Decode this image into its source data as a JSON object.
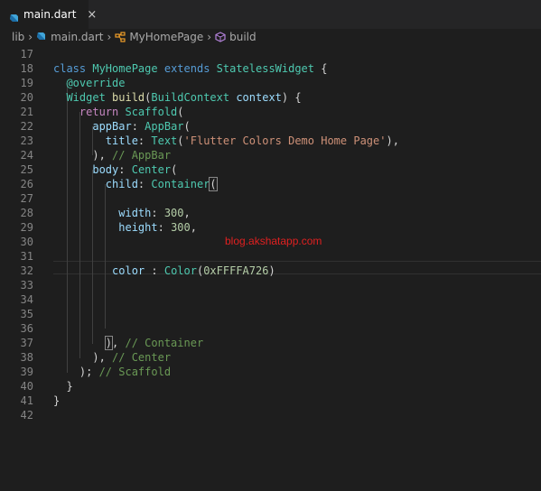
{
  "tab": {
    "label": "main.dart",
    "close": "×",
    "icon": "dart-icon"
  },
  "breadcrumb": {
    "items": [
      {
        "label": "lib",
        "icon": ""
      },
      {
        "label": "main.dart",
        "icon": "dart-icon"
      },
      {
        "label": "MyHomePage",
        "icon": "class-icon"
      },
      {
        "label": "build",
        "icon": "method-icon"
      }
    ]
  },
  "watermark": "blog.akshatapp.com",
  "lines": [
    {
      "n": "17",
      "tokens": []
    },
    {
      "n": "18",
      "tokens": [
        [
          "kw",
          "class "
        ],
        [
          "cls",
          "MyHomePage "
        ],
        [
          "kw",
          "extends "
        ],
        [
          "cls",
          "StatelessWidget"
        ],
        [
          "txt",
          " {"
        ]
      ]
    },
    {
      "n": "19",
      "tokens": [
        [
          "txt",
          "  "
        ],
        [
          "cls",
          "@override"
        ]
      ]
    },
    {
      "n": "20",
      "tokens": [
        [
          "txt",
          "  "
        ],
        [
          "cls",
          "Widget "
        ],
        [
          "fn",
          "build"
        ],
        [
          "txt",
          "("
        ],
        [
          "cls",
          "BuildContext"
        ],
        [
          "par",
          " context"
        ],
        [
          "txt",
          ") {"
        ]
      ]
    },
    {
      "n": "21",
      "tokens": [
        [
          "txt",
          "    "
        ],
        [
          "ctl",
          "return "
        ],
        [
          "cls",
          "Scaffold"
        ],
        [
          "txt",
          "("
        ]
      ]
    },
    {
      "n": "22",
      "tokens": [
        [
          "txt",
          "      "
        ],
        [
          "par",
          "appBar"
        ],
        [
          "txt",
          ": "
        ],
        [
          "cls",
          "AppBar"
        ],
        [
          "txt",
          "("
        ]
      ]
    },
    {
      "n": "23",
      "tokens": [
        [
          "txt",
          "        "
        ],
        [
          "par",
          "title"
        ],
        [
          "txt",
          ": "
        ],
        [
          "cls",
          "Text"
        ],
        [
          "txt",
          "("
        ],
        [
          "str",
          "'Flutter Colors Demo Home Page'"
        ],
        [
          "txt",
          "),"
        ]
      ]
    },
    {
      "n": "24",
      "tokens": [
        [
          "txt",
          "      ), "
        ],
        [
          "cmt",
          "// AppBar"
        ]
      ]
    },
    {
      "n": "25",
      "tokens": [
        [
          "txt",
          "      "
        ],
        [
          "par",
          "body"
        ],
        [
          "txt",
          ": "
        ],
        [
          "cls",
          "Center"
        ],
        [
          "txt",
          "("
        ]
      ]
    },
    {
      "n": "26",
      "tokens": [
        [
          "txt",
          "        "
        ],
        [
          "par",
          "child"
        ],
        [
          "txt",
          ": "
        ],
        [
          "cls",
          "Container"
        ],
        [
          "brk",
          "("
        ]
      ]
    },
    {
      "n": "27",
      "tokens": []
    },
    {
      "n": "28",
      "tokens": [
        [
          "txt",
          "          "
        ],
        [
          "par",
          "width"
        ],
        [
          "txt",
          ": "
        ],
        [
          "num",
          "300"
        ],
        [
          "txt",
          ","
        ]
      ]
    },
    {
      "n": "29",
      "tokens": [
        [
          "txt",
          "          "
        ],
        [
          "par",
          "height"
        ],
        [
          "txt",
          ": "
        ],
        [
          "num",
          "300"
        ],
        [
          "txt",
          ","
        ]
      ]
    },
    {
      "n": "30",
      "tokens": []
    },
    {
      "n": "31",
      "tokens": []
    },
    {
      "n": "32",
      "tokens": [
        [
          "txt",
          "         "
        ],
        [
          "par",
          "color"
        ],
        [
          "txt",
          " : "
        ],
        [
          "cls",
          "Color"
        ],
        [
          "txt",
          "("
        ],
        [
          "num",
          "0xFFFFA726"
        ],
        [
          "txt",
          ")"
        ]
      ]
    },
    {
      "n": "33",
      "tokens": []
    },
    {
      "n": "34",
      "tokens": []
    },
    {
      "n": "35",
      "tokens": []
    },
    {
      "n": "36",
      "tokens": []
    },
    {
      "n": "37",
      "tokens": [
        [
          "txt",
          "        "
        ],
        [
          "brk",
          ")"
        ],
        [
          "txt",
          ", "
        ],
        [
          "cmt",
          "// Container"
        ]
      ]
    },
    {
      "n": "38",
      "tokens": [
        [
          "txt",
          "      ), "
        ],
        [
          "cmt",
          "// Center"
        ]
      ]
    },
    {
      "n": "39",
      "tokens": [
        [
          "txt",
          "    ); "
        ],
        [
          "cmt",
          "// Scaffold"
        ]
      ]
    },
    {
      "n": "40",
      "tokens": [
        [
          "txt",
          "  }"
        ]
      ]
    },
    {
      "n": "41",
      "tokens": [
        [
          "txt",
          "}"
        ]
      ]
    },
    {
      "n": "42",
      "tokens": []
    }
  ]
}
